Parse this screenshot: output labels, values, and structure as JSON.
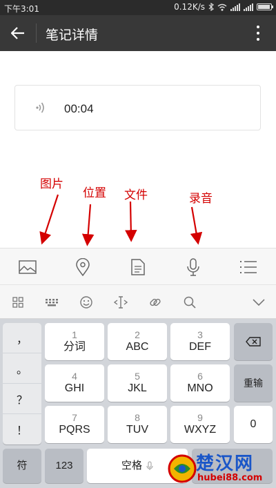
{
  "status_bar": {
    "time": "下午3:01",
    "speed": "0.12K/s"
  },
  "header": {
    "title": "笔记详情"
  },
  "audio": {
    "duration": "00:04"
  },
  "annotations": [
    "图片",
    "位置",
    "文件",
    "录音"
  ],
  "toolbar": {
    "icons": [
      "image-icon",
      "location-icon",
      "file-icon",
      "microphone-icon",
      "list-icon"
    ]
  },
  "ime_bar": {
    "icons": [
      "grid-icon",
      "keyboard-icon",
      "emoji-icon",
      "cursor-icon",
      "link-icon",
      "search-icon",
      "collapse-icon"
    ]
  },
  "keyboard": {
    "symbols": [
      "，",
      "。",
      "？",
      "！"
    ],
    "keys": [
      {
        "num": "1",
        "letters": "分词"
      },
      {
        "num": "2",
        "letters": "ABC"
      },
      {
        "num": "3",
        "letters": "DEF"
      },
      {
        "num": "4",
        "letters": "GHI"
      },
      {
        "num": "5",
        "letters": "JKL"
      },
      {
        "num": "6",
        "letters": "MNO"
      },
      {
        "num": "7",
        "letters": "PQRS"
      },
      {
        "num": "8",
        "letters": "TUV"
      },
      {
        "num": "9",
        "letters": "WXYZ"
      }
    ],
    "reinput": "重输",
    "zero": "0",
    "symbol_key": "符",
    "num_key": "123",
    "space": "空格"
  },
  "watermark": {
    "title": "楚汉网",
    "url": "hubei88.com"
  },
  "colors": {
    "header": "#383838",
    "annotation": "#d40000",
    "keyboard": "#d2d5da"
  }
}
